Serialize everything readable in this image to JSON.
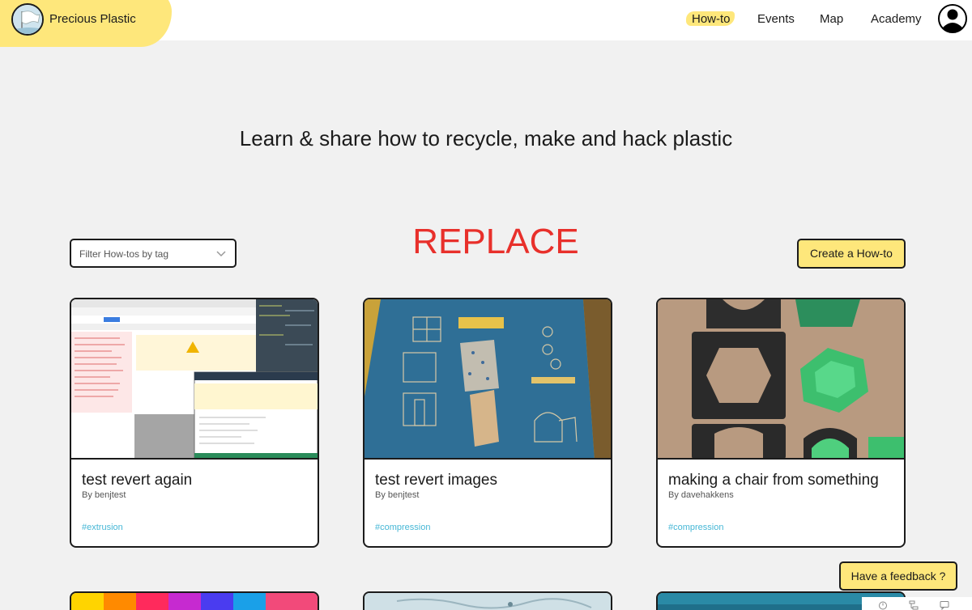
{
  "brand": {
    "name": "Precious Plastic",
    "logo_icon": "flag-logo-icon"
  },
  "nav": {
    "items": [
      {
        "label": "How-to",
        "active": true
      },
      {
        "label": "Events"
      },
      {
        "label": "Map"
      },
      {
        "label": "Academy"
      }
    ],
    "avatar_icon": "user-avatar-icon"
  },
  "hero": {
    "title": "Learn & share how to recycle, make and hack plastic"
  },
  "filter": {
    "placeholder": "Filter How-tos by tag",
    "icon": "chevron-down-icon"
  },
  "overlay_text": "REPLACE",
  "create_button": "Create a How-to",
  "cards": [
    {
      "title": "test revert again",
      "author": "By benjtest",
      "tag": "#extrusion",
      "image": "browser-screenshot"
    },
    {
      "title": "test revert images",
      "author": "By benjtest",
      "tag": "#compression",
      "image": "blueprint-photo"
    },
    {
      "title": "making a chair from something",
      "author": "By davehakkens",
      "tag": "#compression",
      "image": "molds-photo"
    }
  ],
  "feedback_button": "Have a feedback ?",
  "colors": {
    "accent": "#fee77b",
    "tag": "#46b7d6",
    "overlay": "#e8302b",
    "background": "#f1f1f1"
  }
}
